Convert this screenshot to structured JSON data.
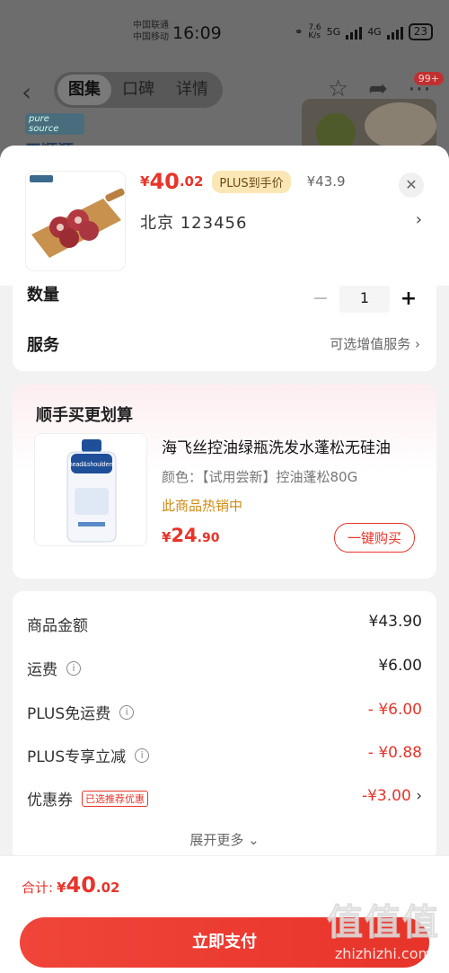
{
  "status_bar": {
    "carrier1": "中国联通",
    "carrier2": "中国移动",
    "time": "16:09",
    "speed": "7.6\nK/s",
    "net1": "5G",
    "net2": "4G",
    "battery": "23"
  },
  "nav": {
    "tabs": [
      "图集",
      "口碑",
      "详情"
    ],
    "badge": "99+"
  },
  "brand": {
    "pill": "pure source",
    "name": "天顺源"
  },
  "product": {
    "price_yen": "¥",
    "price_int": "40",
    "price_dec": ".02",
    "plus_tag": "PLUS到手价",
    "original_price": "¥43.9",
    "address": "北京  123456"
  },
  "quantity": {
    "label": "数量",
    "value": "1",
    "minus": "−",
    "plus": "+"
  },
  "service": {
    "label": "服务",
    "right": "可选增值服务"
  },
  "upsell": {
    "title": "顺手买更划算",
    "name": "海飞丝控油绿瓶洗发水蓬松无硅油",
    "attr": "颜色：【试用尝新】控油蓬松80G",
    "hot": "此商品热销中",
    "price_yen": "¥",
    "price_int": "24",
    "price_dec": ".90",
    "buy_label": "一键购买",
    "bottle_brand": "head&shoulders"
  },
  "summary": {
    "rows": [
      {
        "label": "商品金额",
        "value": "¥43.90"
      },
      {
        "label": "运费",
        "value": "¥6.00"
      },
      {
        "label": "PLUS免运费",
        "value": "- ¥6.00"
      },
      {
        "label": "PLUS专享立减",
        "value": "- ¥0.88"
      },
      {
        "label": "优惠券",
        "tag": "已选推荐优惠",
        "value": "-¥3.00"
      }
    ],
    "more": "展开更多"
  },
  "footer": {
    "total_label": "合计:",
    "total_yen": "¥",
    "total_int": "40",
    "total_dec": ".02",
    "pay_label": "立即支付"
  },
  "watermark": {
    "big": "值值值",
    "site": "zhizhizhi.com"
  },
  "colors": {
    "accent": "#e8342a",
    "plus_gold": "#fbe7b6",
    "hot_orange": "#d08a10"
  }
}
